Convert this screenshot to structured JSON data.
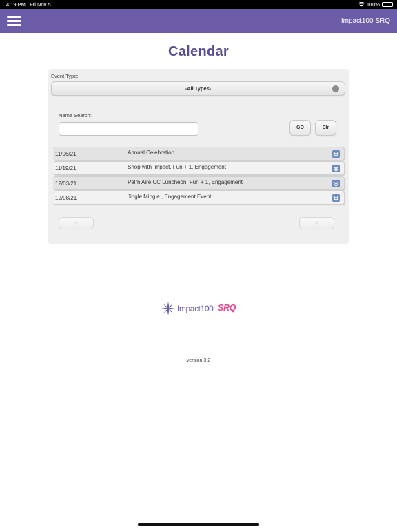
{
  "status_bar": {
    "time": "4:19 PM",
    "date": "Fri Nov 5",
    "battery": "100%",
    "battery_level": 1.0
  },
  "nav": {
    "menu_icon": "hamburger-menu-icon",
    "title": "Impact100 SRQ",
    "color": "#6c5ba6"
  },
  "page": {
    "title": "Calendar",
    "title_color": "#5a4d93"
  },
  "filter": {
    "event_type_label": "Event Type:",
    "event_type_value": "-All Types-",
    "name_search_label": "Name Search:",
    "name_search_value": "",
    "go_label": "GO",
    "clear_label": "Clr"
  },
  "events": [
    {
      "date": "11/06/21",
      "title": "Annual Celebration",
      "background": "#e3e3e3"
    },
    {
      "date": "11/19/21",
      "title": "Shop with Impact, Fun + 1, Engagement",
      "background": "#f2f2f2"
    },
    {
      "date": "12/03/21",
      "title": "Palm Aire CC Luncheon, Fun + 1, Engagement",
      "background": "#e3e3e3"
    },
    {
      "date": "12/08/21",
      "title": "Jingle Mingle , Engagement Event",
      "background": "#f2f2f2"
    }
  ],
  "pager": {
    "prev_label": "<",
    "next_label": ">"
  },
  "logo": {
    "text": "Impact100",
    "accent": "SRQ",
    "accent_color": "#e04a8c",
    "icon": "star-burst-icon"
  },
  "footer": {
    "version": "version 3.2"
  }
}
